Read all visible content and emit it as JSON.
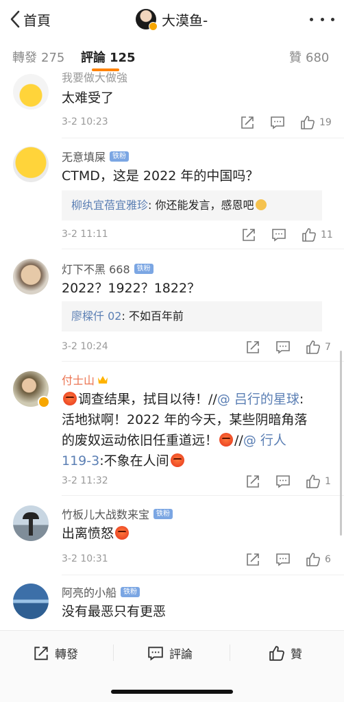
{
  "nav": {
    "back_label": "首頁",
    "title": "大漠鱼-"
  },
  "tabs": [
    {
      "label": "轉發",
      "count": "275"
    },
    {
      "label": "評論",
      "count": "125"
    },
    {
      "label": "贊",
      "count": "680"
    }
  ],
  "comments": [
    {
      "user": "我要做大做強",
      "text": "太难受了",
      "time": "3-2 10:23",
      "likes": "19"
    },
    {
      "user": "无意填屎",
      "badge": "铁粉",
      "text": "CTMD，这是 2022 年的中国吗？",
      "reply_user": "柳纨宜蓓宜雅珍",
      "reply_text": ": 你还能发言，感恩吧",
      "time": "3-2 11:11",
      "likes": "11"
    },
    {
      "user": "灯下不黑 668",
      "badge": "铁粉",
      "text": "2022？1922？1822？",
      "reply_user": "廖樑仟 02",
      "reply_text": ": 不如百年前",
      "time": "3-2 10:24",
      "likes": "7"
    },
    {
      "user": "付士山",
      "line1_text": "调查结果，拭目以待！//",
      "line1_link": "@ 吕行的星球",
      "line1_end": ":",
      "line2": "活地狱啊！2022 年的今天，某些阴暗角落",
      "line3_text": "的废奴运动依旧任重道远！",
      "line3_link": "@ 行人",
      "line3_sep": "//",
      "line4_link": "119-3",
      "line4_text": ":不象在人间",
      "time": "3-2 11:32",
      "likes": "1"
    },
    {
      "user": "竹板儿大战数来宝",
      "badge": "铁粉",
      "text": "出离愤怒",
      "time": "3-2 10:31",
      "likes": "6"
    },
    {
      "user": "阿亮的小船",
      "badge": "铁粉",
      "text": "没有最恶只有更恶"
    }
  ],
  "bottom": {
    "repost": "轉發",
    "comment": "評論",
    "like": "贊"
  },
  "icons": {
    "back": "chevron-left-icon",
    "more": "more-dots-icon",
    "share": "share-icon",
    "comment": "comment-icon",
    "like": "thumbs-up-icon"
  }
}
